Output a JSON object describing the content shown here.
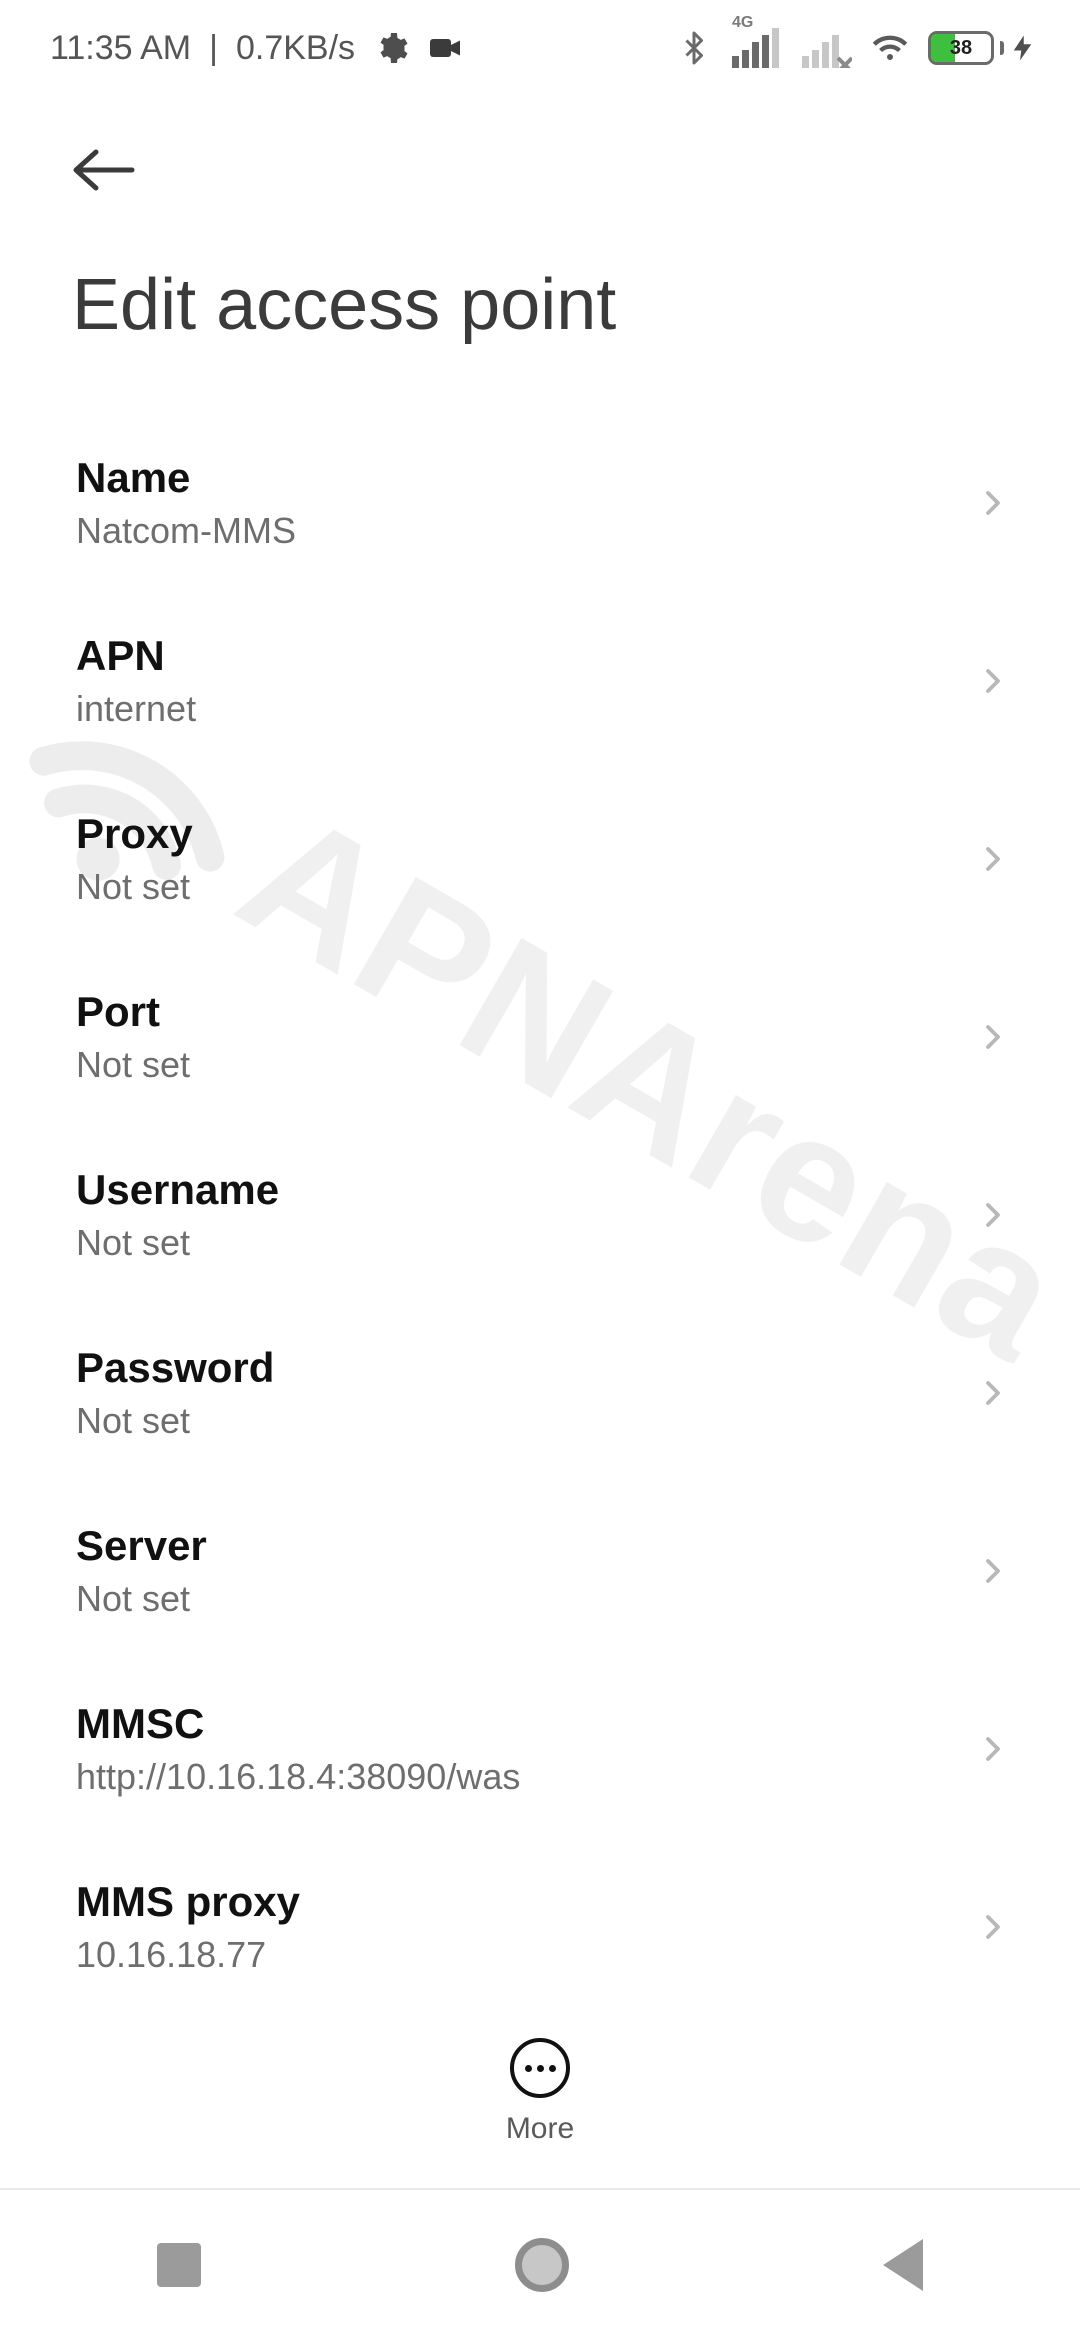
{
  "status_bar": {
    "time": "11:35 AM",
    "speed": "0.7KB/s",
    "network_tag": "4G",
    "battery_percent": "38",
    "battery_fill_pct": 40
  },
  "header": {
    "title": "Edit access point"
  },
  "settings": [
    {
      "label": "Name",
      "value": "Natcom-MMS"
    },
    {
      "label": "APN",
      "value": "internet"
    },
    {
      "label": "Proxy",
      "value": "Not set"
    },
    {
      "label": "Port",
      "value": "Not set"
    },
    {
      "label": "Username",
      "value": "Not set"
    },
    {
      "label": "Password",
      "value": "Not set"
    },
    {
      "label": "Server",
      "value": "Not set"
    },
    {
      "label": "MMSC",
      "value": "http://10.16.18.4:38090/was"
    },
    {
      "label": "MMS proxy",
      "value": "10.16.18.77"
    }
  ],
  "more": {
    "label": "More"
  },
  "watermark": {
    "text": "APNArena"
  }
}
